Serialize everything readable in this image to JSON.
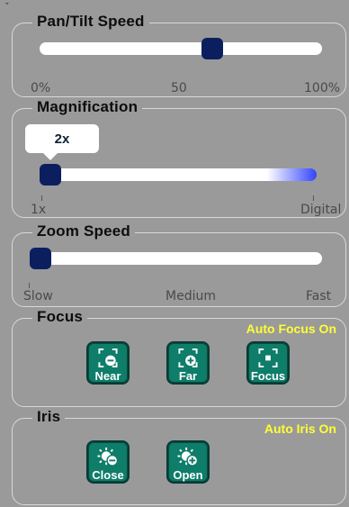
{
  "pan_tilt": {
    "title": "Pan/Tilt Speed",
    "value_fraction": 0.61,
    "labels": {
      "min": "0%",
      "mid": "50",
      "max": "100%"
    }
  },
  "magnification": {
    "title": "Magnification",
    "value_text": "2x",
    "value_fraction": 0.0,
    "labels": {
      "min": "1x",
      "max": "Digital"
    }
  },
  "zoom_speed": {
    "title": "Zoom Speed",
    "value_fraction": 0.0,
    "labels": {
      "min": "Slow",
      "mid": "Medium",
      "max": "Fast"
    }
  },
  "focus": {
    "title": "Focus",
    "status": "Auto Focus On",
    "buttons": {
      "near": "Near",
      "far": "Far",
      "focus": "Focus"
    }
  },
  "iris": {
    "title": "Iris",
    "status": "Auto Iris On",
    "buttons": {
      "close": "Close",
      "open": "Open"
    }
  },
  "colors": {
    "thumb": "#0b1f5e",
    "button": "#0e7d6a",
    "status_text": "#ffff33",
    "mag_gradient_end": "#3344ff"
  }
}
